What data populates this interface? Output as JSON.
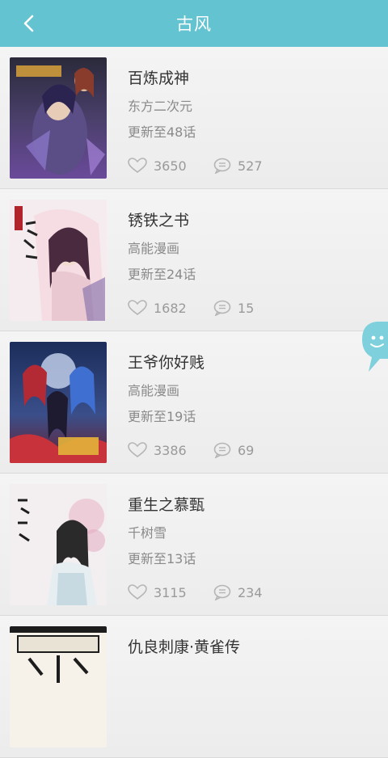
{
  "header": {
    "title": "古风"
  },
  "comics": [
    {
      "title": "百炼成神",
      "author": "东方二次元",
      "update": "更新至48话",
      "likes": "3650",
      "comments": "527"
    },
    {
      "title": "锈铁之书",
      "author": "高能漫画",
      "update": "更新至24话",
      "likes": "1682",
      "comments": "15"
    },
    {
      "title": "王爷你好贱",
      "author": "高能漫画",
      "update": "更新至19话",
      "likes": "3386",
      "comments": "69"
    },
    {
      "title": "重生之慕甄",
      "author": "千树雪",
      "update": "更新至13话",
      "likes": "3115",
      "comments": "234"
    },
    {
      "title": "仇良刺康·黄雀传",
      "author": "",
      "update": "",
      "likes": "",
      "comments": ""
    }
  ],
  "icons": {
    "back": "chevron-left-icon",
    "like": "heart-icon",
    "comment": "comment-bubble-icon",
    "float": "chat-bubble-icon"
  },
  "colors": {
    "header": "#63c3d1",
    "float_bubble": "#7dd0dc"
  }
}
